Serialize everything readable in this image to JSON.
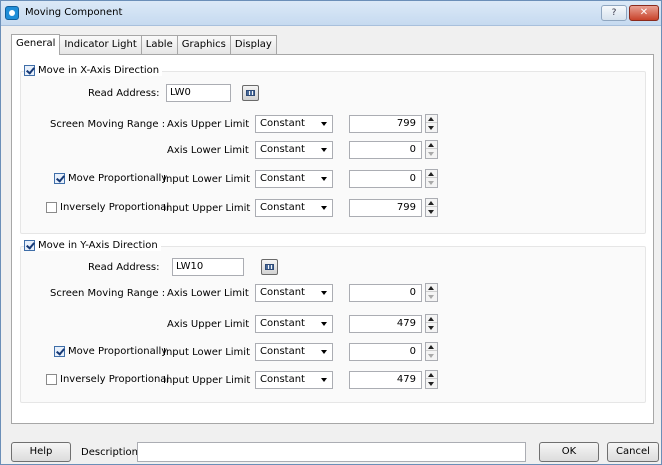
{
  "window": {
    "title": "Moving Component",
    "help_label": "?",
    "close_label": "✕"
  },
  "tabs": [
    "General",
    "Indicator Light",
    "Lable",
    "Graphics",
    "Display"
  ],
  "x_axis": {
    "enable_label": "Move in X-Axis Direction",
    "enabled": true,
    "read_address_label": "Read Address:",
    "read_address": "LW0",
    "range_label": "Screen Moving Range :",
    "move_prop_label": "Move Proportionally",
    "move_prop": true,
    "inverse_label": "Inversely Proportional",
    "inverse": false,
    "rows": [
      {
        "label": "Axis Upper Limit",
        "mode": "Constant",
        "value": "799",
        "down_dim": false
      },
      {
        "label": "Axis Lower Limit",
        "mode": "Constant",
        "value": "0",
        "down_dim": true
      },
      {
        "label": "Input Lower Limit",
        "mode": "Constant",
        "value": "0",
        "down_dim": true
      },
      {
        "label": "Input Upper Limit",
        "mode": "Constant",
        "value": "799",
        "down_dim": false
      }
    ]
  },
  "y_axis": {
    "enable_label": "Move in Y-Axis Direction",
    "enabled": true,
    "read_address_label": "Read Address:",
    "read_address": "LW10",
    "range_label": "Screen Moving Range :",
    "move_prop_label": "Move Proportionally",
    "move_prop": true,
    "inverse_label": "Inversely Proportional",
    "inverse": false,
    "rows": [
      {
        "label": "Axis Lower Limit",
        "mode": "Constant",
        "value": "0",
        "down_dim": true
      },
      {
        "label": "Axis Upper Limit",
        "mode": "Constant",
        "value": "479",
        "down_dim": false
      },
      {
        "label": "Input Lower Limit",
        "mode": "Constant",
        "value": "0",
        "down_dim": true
      },
      {
        "label": "Input Upper Limit",
        "mode": "Constant",
        "value": "479",
        "down_dim": false
      }
    ]
  },
  "footer": {
    "help_label": "Help",
    "description_label": "Description:",
    "description_value": "",
    "ok_label": "OK",
    "cancel_label": "Cancel"
  }
}
